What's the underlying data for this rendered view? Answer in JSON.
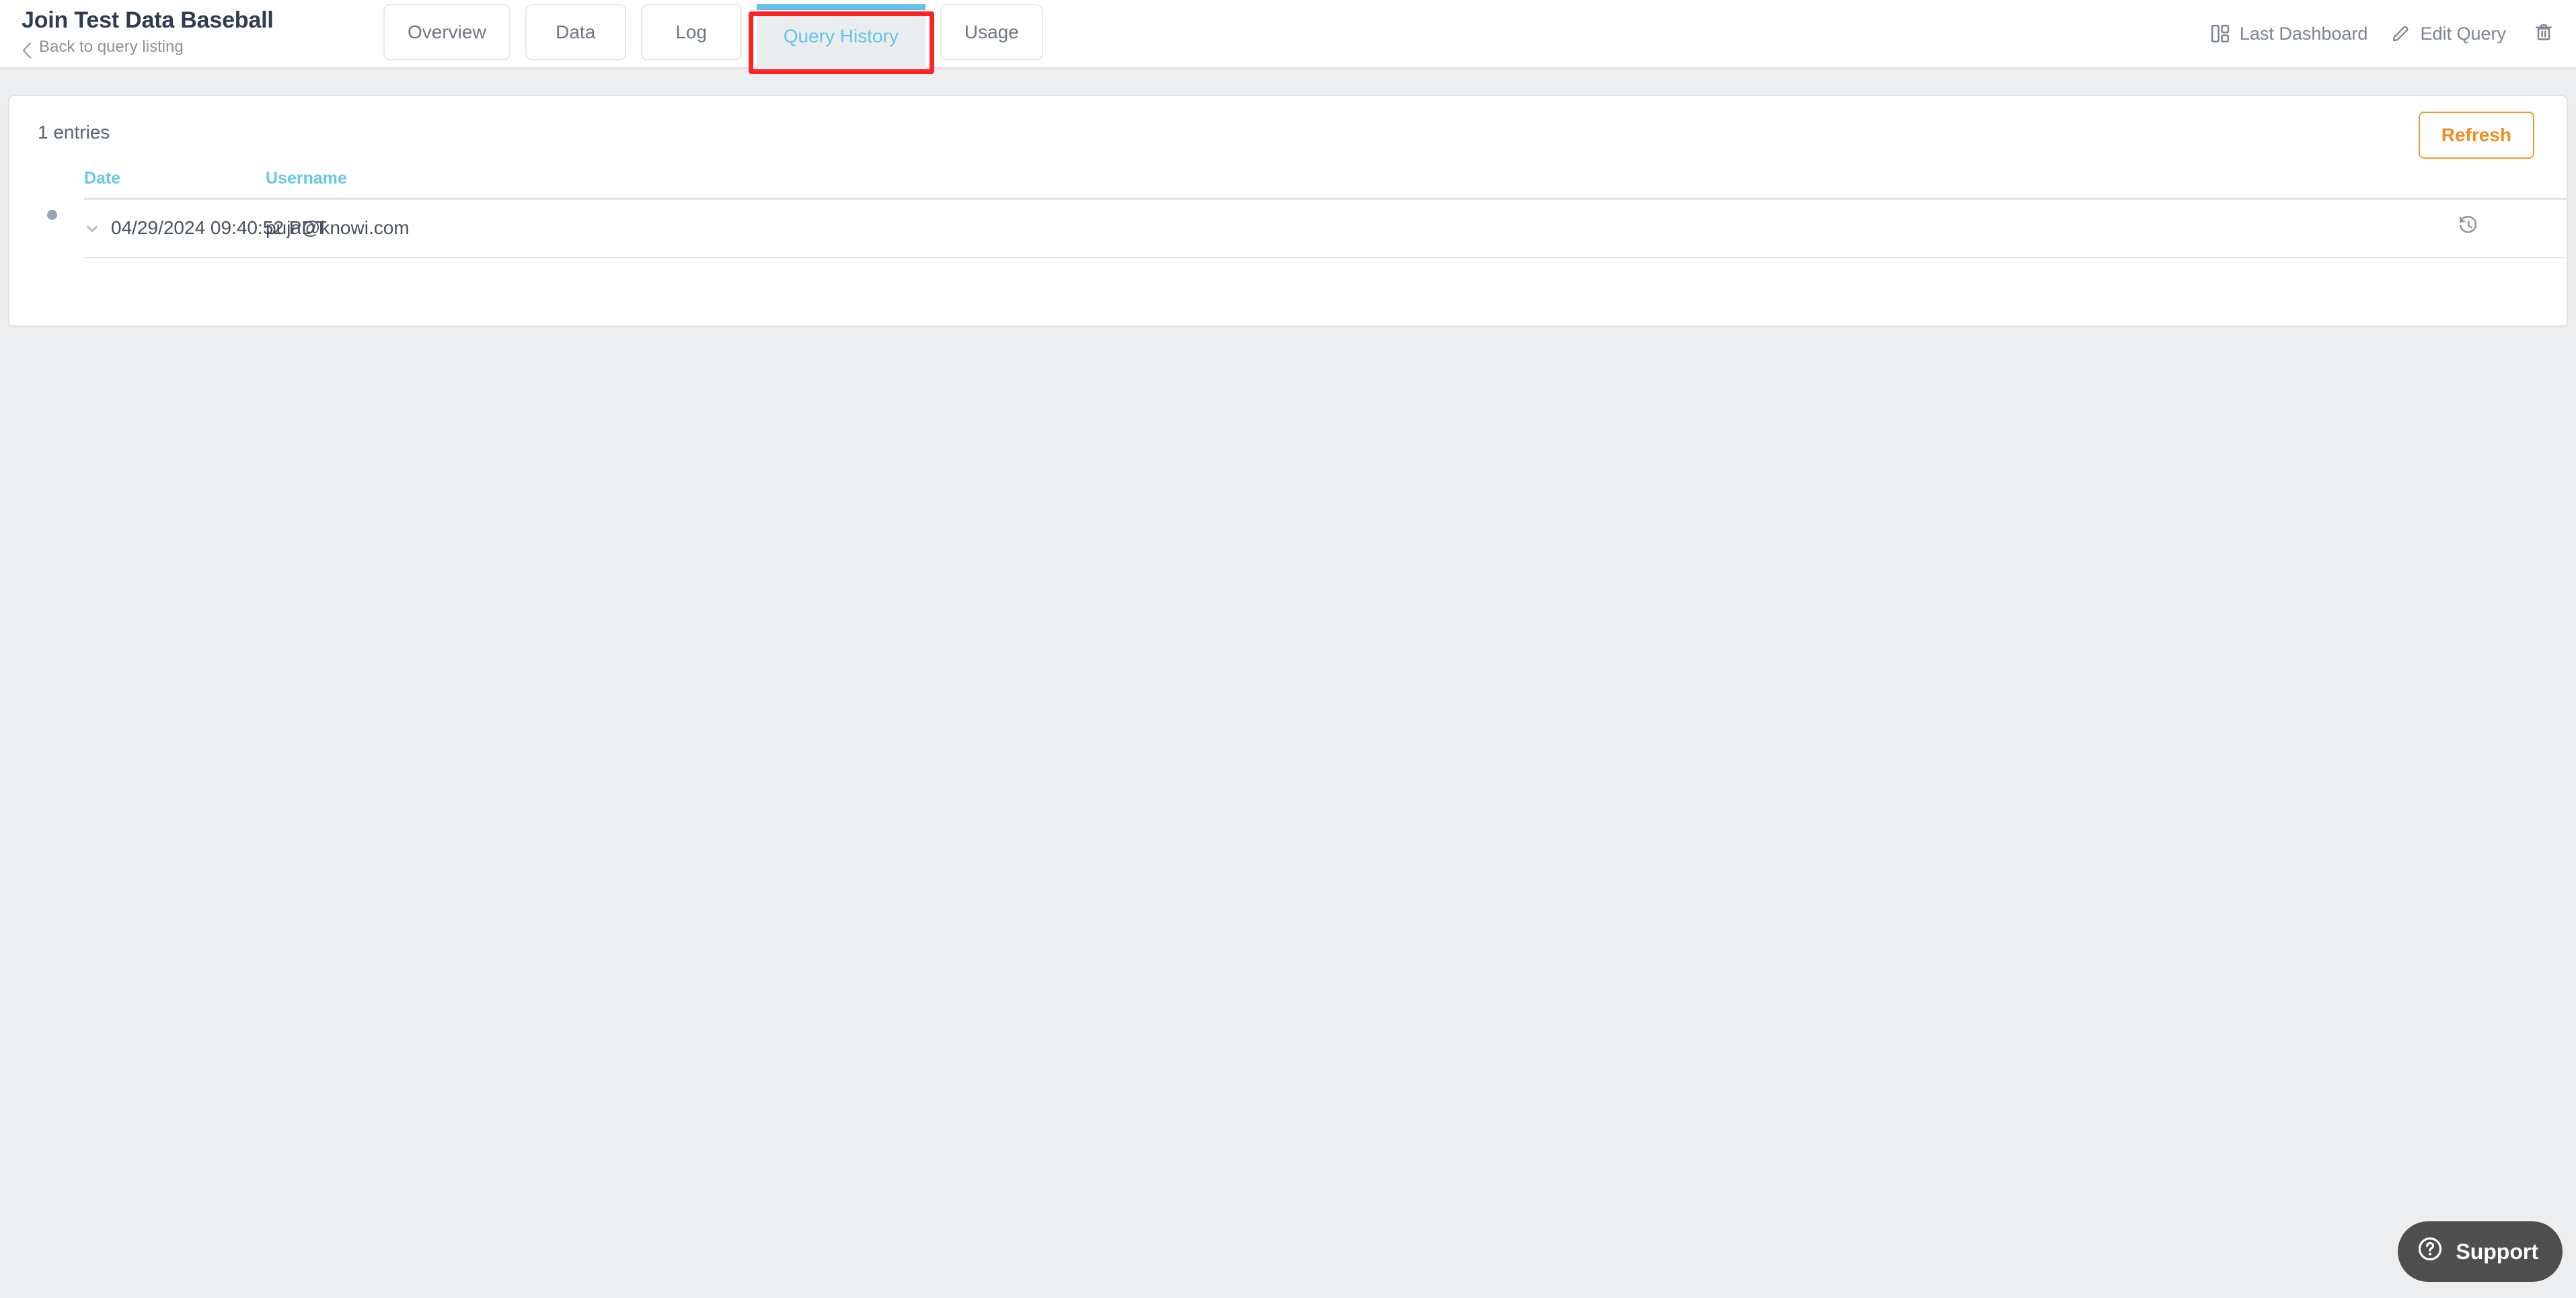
{
  "header": {
    "title": "Join Test Data Baseball",
    "back_link": "Back to query listing",
    "back_icon": "chevron-left-icon",
    "tabs": [
      {
        "label": "Overview",
        "active": false
      },
      {
        "label": "Data",
        "active": false
      },
      {
        "label": "Log",
        "active": false
      },
      {
        "label": "Query History",
        "active": true
      },
      {
        "label": "Usage",
        "active": false
      }
    ],
    "actions": {
      "last_dashboard": "Last Dashboard",
      "last_dashboard_icon": "dashboard-grid-icon",
      "edit_query": "Edit Query",
      "edit_query_icon": "pencil-icon",
      "delete_icon": "trash-icon"
    }
  },
  "annotation": {
    "target": "Query History",
    "color": "#fb2323"
  },
  "card": {
    "entries_count": "1 entries",
    "refresh_label": "Refresh",
    "table": {
      "columns": [
        "Date",
        "Username"
      ],
      "rows": [
        {
          "date": "04/29/2024 09:40:52 PDT",
          "username": "puja@knowi.com",
          "expand_icon": "chevron-down-icon",
          "restore_icon": "history-restore-icon"
        }
      ]
    }
  },
  "support": {
    "label": "Support",
    "icon": "question-circle-icon"
  },
  "colors": {
    "accent_blue": "#63c3ec",
    "accent_orange": "#ee8e1f",
    "annotation_red": "#fb2323",
    "page_background": "#eceef0",
    "text_dark": "#2f3b4e",
    "text_muted": "#7b8491"
  }
}
